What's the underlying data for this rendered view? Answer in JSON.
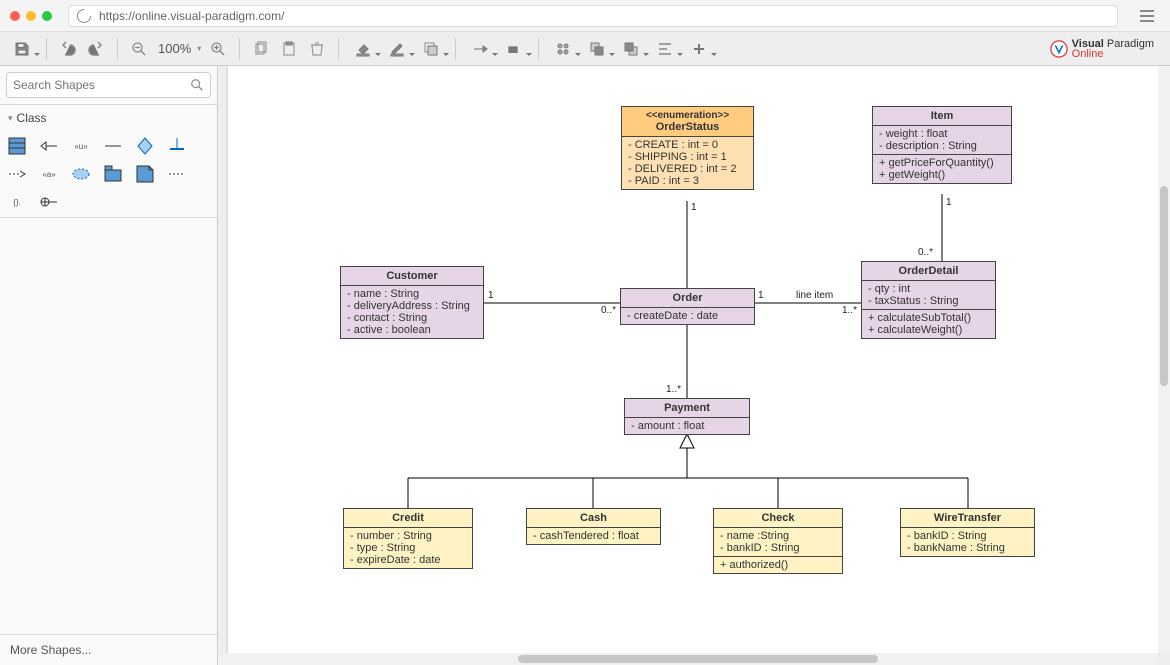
{
  "url": "https://online.visual-paradigm.com/",
  "brand": {
    "name1": "Visual",
    "name2": "Paradigm",
    "sub": "Online"
  },
  "toolbar": {
    "zoom": "100%"
  },
  "search": {
    "placeholder": "Search Shapes"
  },
  "sidebar": {
    "category": "Class",
    "more": "More Shapes..."
  },
  "diagram": {
    "orderStatus": {
      "stereo": "<<enumeration>>",
      "name": "OrderStatus",
      "attrs": [
        "- CREATE : int  = 0",
        "- SHIPPING : int = 1",
        "- DELIVERED : int = 2",
        "- PAID : int = 3"
      ]
    },
    "item": {
      "name": "Item",
      "attrs": [
        "- weight : float",
        "- description : String"
      ],
      "ops": [
        "+ getPriceForQuantity()",
        "+ getWeight()"
      ]
    },
    "customer": {
      "name": "Customer",
      "attrs": [
        "- name : String",
        "- deliveryAddress : String",
        "- contact : String",
        "- active : boolean"
      ]
    },
    "order": {
      "name": "Order",
      "attrs": [
        "- createDate : date"
      ]
    },
    "orderDetail": {
      "name": "OrderDetail",
      "attrs": [
        "- qty : int",
        "- taxStatus : String"
      ],
      "ops": [
        "+ calculateSubTotal()",
        "+ calculateWeight()"
      ]
    },
    "payment": {
      "name": "Payment",
      "attrs": [
        "- amount : float"
      ]
    },
    "credit": {
      "name": "Credit",
      "attrs": [
        "- number : String",
        "- type : String",
        "- expireDate : date"
      ]
    },
    "cash": {
      "name": "Cash",
      "attrs": [
        "- cashTendered : float"
      ]
    },
    "check": {
      "name": "Check",
      "attrs": [
        "- name :String",
        "- bankID : String"
      ],
      "ops": [
        "+ authorized()"
      ]
    },
    "wire": {
      "name": "WireTransfer",
      "attrs": [
        "- bankID : String",
        "- bankName : String"
      ]
    },
    "labels": {
      "one_a": "1",
      "one_b": "1",
      "zeroStar_a": "0..*",
      "one_c": "1",
      "oneStar": "1..*",
      "one_d": "1",
      "zeroStar_b": "0..*",
      "lineItem": "line item",
      "oneStar_pay": "1..*"
    }
  }
}
